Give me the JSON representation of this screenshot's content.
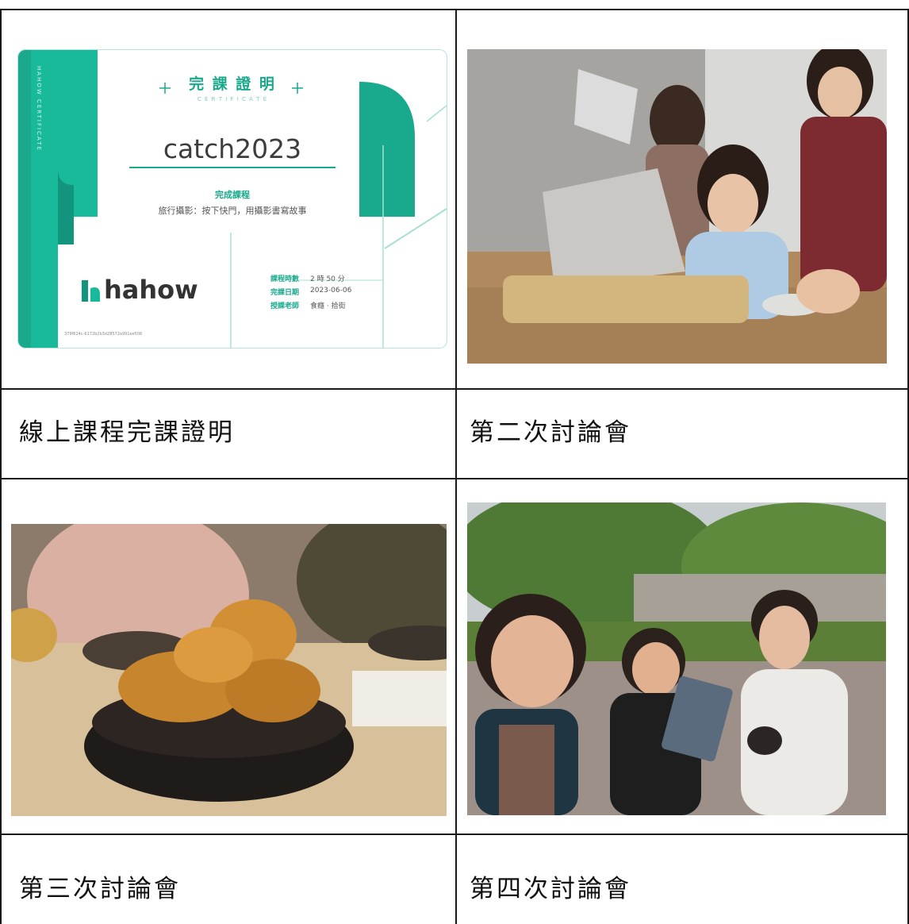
{
  "captions": {
    "top_left": "線上課程完課證明",
    "top_right": "第二次討論會",
    "bottom_left": "第三次討論會",
    "bottom_right": "第四次討論會"
  },
  "certificate": {
    "heading": "完 課 證 明",
    "subheading": "C E R T I F I C A T E",
    "name": "catch2023",
    "complete_label": "完成課程",
    "course_title": "旅行攝影：按下快門，用攝影書寫故事",
    "brand": "hahow",
    "hours_label": "課程時數",
    "hours_value": "2 時 50 分",
    "date_label": "完課日期",
    "date_value": "2023-06-06",
    "teacher_label": "授課老師",
    "teacher_value": "食癮 · 拾街",
    "serial": "379f624c-6172b2b3d28572a991ee506",
    "vertical_text": "HAHOW CERTIFICATE",
    "accent": "#1aa98c"
  }
}
